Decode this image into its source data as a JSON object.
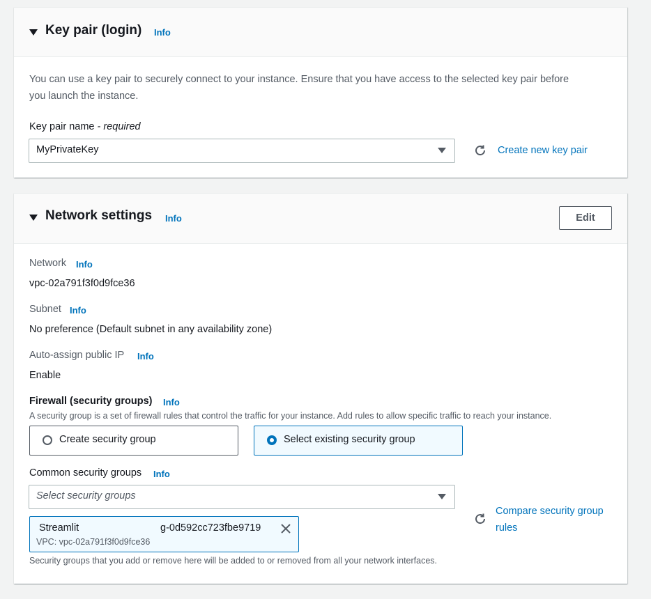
{
  "key_pair": {
    "title": "Key pair (login)",
    "info": "Info",
    "description_line1": "You can use a key pair to securely connect to your instance. Ensure that you have access to the selected key pair before",
    "description_line2": "you launch the instance.",
    "name_label": "Key pair name",
    "name_label_suffix": "- required",
    "selected_value": "MyPrivateKey",
    "create_link": "Create new key pair"
  },
  "network": {
    "title": "Network settings",
    "info": "Info",
    "edit_button": "Edit",
    "network_label": "Network",
    "network_value": "vpc-02a791f3f0d9fce36",
    "subnet_label": "Subnet",
    "subnet_value": "No preference (Default subnet in any availability zone)",
    "public_ip_label": "Auto-assign public IP",
    "public_ip_value": "Enable",
    "firewall_label": "Firewall (security groups)",
    "firewall_description": "A security group is a set of firewall rules that control the traffic for your instance. Add rules to allow specific traffic to reach your instance.",
    "option_create": "Create security group",
    "option_select": "Select existing security group",
    "selected_option": "Select existing security group",
    "common_sg_label": "Common security groups",
    "common_sg_placeholder": "Select security groups",
    "compare_link_line1": "Compare security group",
    "compare_link_line2": "rules",
    "token_name": "Streamlit",
    "token_id": "g-0d592cc723fbe9719",
    "token_vpc": "VPC: vpc-02a791f3f0d9fce36",
    "footer_note": "Security groups that you add or remove here will be added to or removed from all your network interfaces."
  },
  "colors": {
    "accent": "#0073bb",
    "background": "#f2f3f3",
    "header": "#fafafa"
  }
}
